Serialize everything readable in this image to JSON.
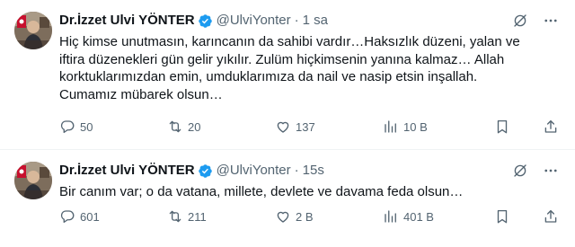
{
  "tweets": [
    {
      "author_name": "Dr.İzzet Ulvi YÖNTER",
      "handle": "@UlviYonter",
      "separator": "·",
      "time": "1 sa",
      "text_lines": [
        "Hiç kimse unutmasın, karıncanın da sahibi vardır…Haksızlık düzeni, yalan ve",
        "iftira düzenekleri gün gelir yıkılır. Zulüm hiçkimsenin yanına kalmaz… Allah",
        "korktuklarımızdan emin, umduklarımıza da nail ve nasip etsin inşallah.",
        "Cumamız mübarek olsun…"
      ],
      "stats": {
        "replies": "50",
        "reposts": "20",
        "likes": "137",
        "views": "10 B"
      }
    },
    {
      "author_name": "Dr.İzzet Ulvi YÖNTER",
      "handle": "@UlviYonter",
      "separator": "·",
      "time": "15s",
      "text_lines": [
        "Bir canım var; o da vatana, millete, devlete ve davama feda olsun…"
      ],
      "stats": {
        "replies": "601",
        "reposts": "211",
        "likes": "2 B",
        "views": "401 B"
      }
    }
  ],
  "colors": {
    "text": "#0f1419",
    "secondary": "#536471",
    "verified": "#1d9bf0",
    "divider": "#eff3f4"
  },
  "icons": [
    "verified-badge-icon",
    "grok-icon",
    "more-icon",
    "reply-icon",
    "retweet-icon",
    "like-icon",
    "views-icon",
    "bookmark-icon",
    "share-icon"
  ]
}
